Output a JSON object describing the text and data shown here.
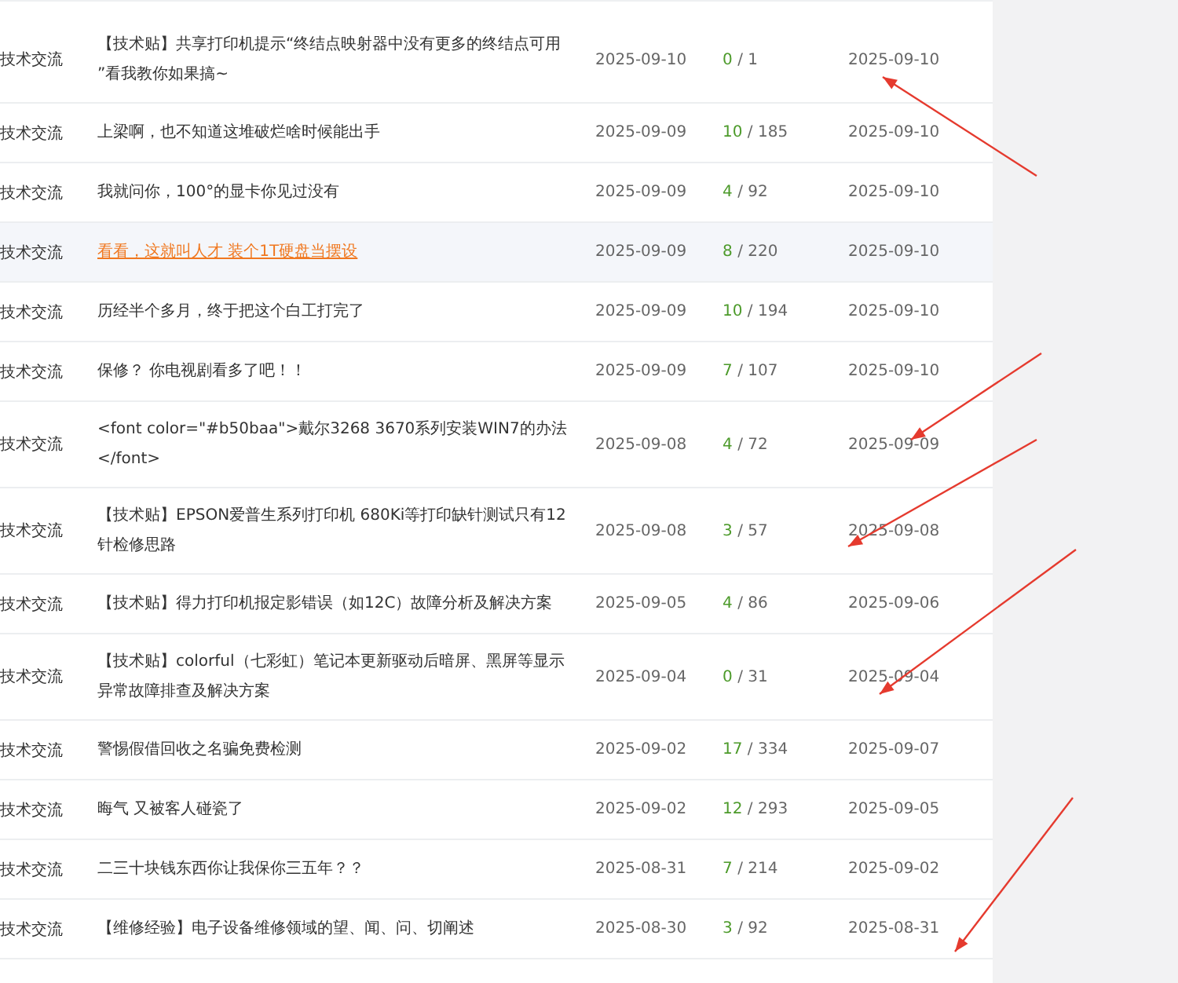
{
  "threads": [
    {
      "category": "技术交流",
      "title": "【技术贴】共享打印机提示“终结点映射器中没有更多的终结点可用 ”看我教你如果搞~",
      "highlighted": false,
      "posted": "2025-09-10",
      "replies": "0",
      "views": "/ 1",
      "last_reply": "2025-09-10"
    },
    {
      "category": "技术交流",
      "title": "上梁啊，也不知道这堆破烂啥时候能出手",
      "highlighted": false,
      "posted": "2025-09-09",
      "replies": "10",
      "views": "/ 185",
      "last_reply": "2025-09-10"
    },
    {
      "category": "技术交流",
      "title": "我就问你，100°的显卡你见过没有",
      "highlighted": false,
      "posted": "2025-09-09",
      "replies": "4",
      "views": "/ 92",
      "last_reply": "2025-09-10"
    },
    {
      "category": "技术交流",
      "title": "看看，这就叫人才 装个1T硬盘当摆设",
      "highlighted": true,
      "posted": "2025-09-09",
      "replies": "8",
      "views": "/ 220",
      "last_reply": "2025-09-10"
    },
    {
      "category": "技术交流",
      "title": "历经半个多月，终于把这个白工打完了",
      "highlighted": false,
      "posted": "2025-09-09",
      "replies": "10",
      "views": "/ 194",
      "last_reply": "2025-09-10"
    },
    {
      "category": "技术交流",
      "title": "保修？ 你电视剧看多了吧！！",
      "highlighted": false,
      "posted": "2025-09-09",
      "replies": "7",
      "views": "/ 107",
      "last_reply": "2025-09-10"
    },
    {
      "category": "技术交流",
      "title": "<font color=\"#b50baa\">戴尔3268 3670系列安装WIN7的办法</font>",
      "highlighted": false,
      "posted": "2025-09-08",
      "replies": "4",
      "views": "/ 72",
      "last_reply": "2025-09-09"
    },
    {
      "category": "技术交流",
      "title": "【技术贴】EPSON爱普生系列打印机 680Ki等打印缺针测试只有12针检修思路",
      "highlighted": false,
      "posted": "2025-09-08",
      "replies": "3",
      "views": "/ 57",
      "last_reply": "2025-09-08"
    },
    {
      "category": "技术交流",
      "title": "【技术贴】得力打印机报定影错误（如12C）故障分析及解决方案",
      "highlighted": false,
      "posted": "2025-09-05",
      "replies": "4",
      "views": "/ 86",
      "last_reply": "2025-09-06"
    },
    {
      "category": "技术交流",
      "title": "【技术贴】colorful（七彩虹）笔记本更新驱动后暗屏、黑屏等显示异常故障排查及解决方案",
      "highlighted": false,
      "posted": "2025-09-04",
      "replies": "0",
      "views": "/ 31",
      "last_reply": "2025-09-04"
    },
    {
      "category": "技术交流",
      "title": "警惕假借回收之名骗免费检测",
      "highlighted": false,
      "posted": "2025-09-02",
      "replies": "17",
      "views": "/ 334",
      "last_reply": "2025-09-07"
    },
    {
      "category": "技术交流",
      "title": "晦气 又被客人碰瓷了",
      "highlighted": false,
      "posted": "2025-09-02",
      "replies": "12",
      "views": "/ 293",
      "last_reply": "2025-09-05"
    },
    {
      "category": "技术交流",
      "title": "二三十块钱东西你让我保你三五年？？",
      "highlighted": false,
      "posted": "2025-08-31",
      "replies": "7",
      "views": "/ 214",
      "last_reply": "2025-09-02"
    },
    {
      "category": "技术交流",
      "title": "【维修经验】电子设备维修领域的望、闻、问、切阐述",
      "highlighted": false,
      "posted": "2025-08-30",
      "replies": "3",
      "views": "/ 92",
      "last_reply": "2025-08-31"
    }
  ]
}
